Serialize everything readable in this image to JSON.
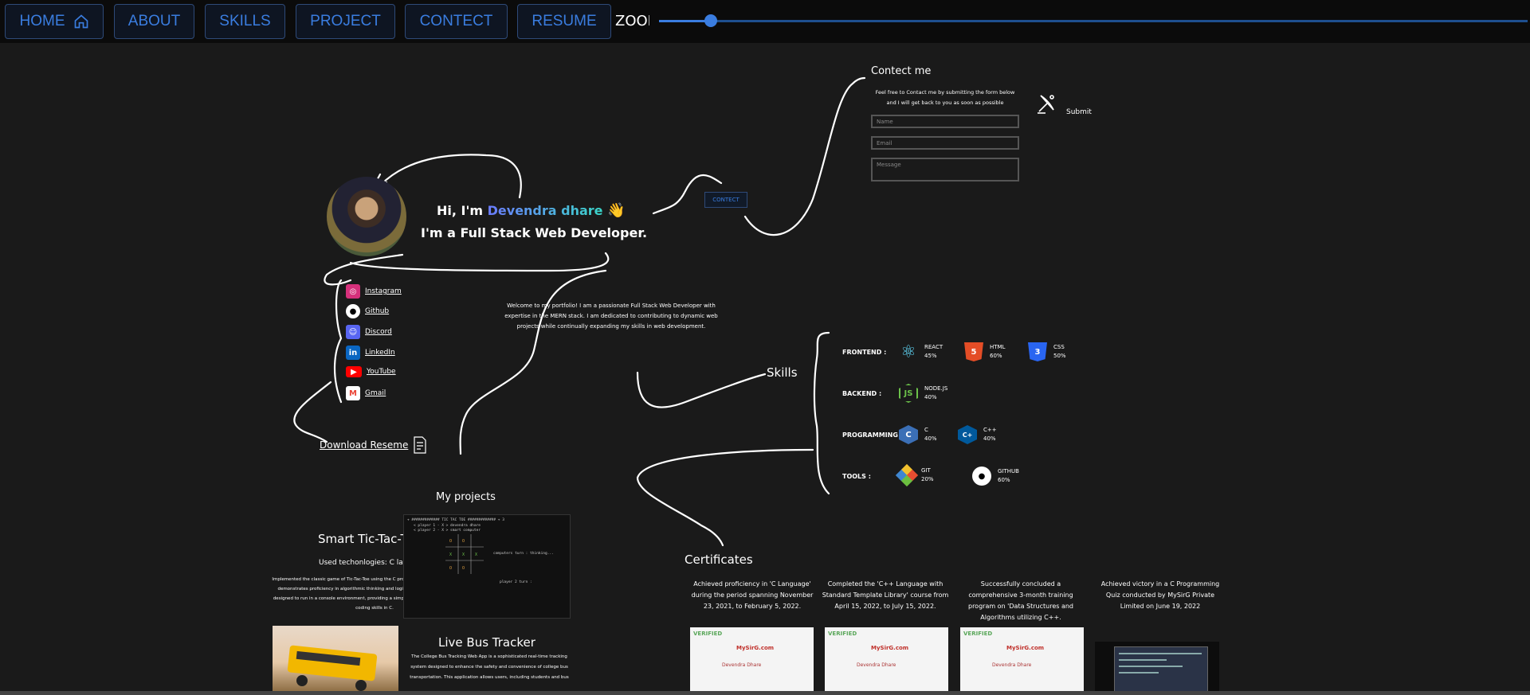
{
  "nav": {
    "home": "HOME",
    "about": "ABOUT",
    "skills": "SKILLS",
    "project": "PROJECT",
    "contect": "CONTECT",
    "resume": "RESUME"
  },
  "zoom": {
    "label": "ZOOM",
    "value": 0.06
  },
  "hero": {
    "greeting_prefix": "Hi, I'm ",
    "name": "Devendra dhare",
    "wave": "👋",
    "role": "I'm a Full Stack Web Developer.",
    "intro": "Welcome to my portfolio! I am a passionate Full Stack Web Developer with expertise in the MERN stack. I am dedicated to contributing to dynamic web projects while continually expanding my skills in web development.",
    "contect_button": "CONTECT"
  },
  "social": [
    {
      "label": "Instagram",
      "icon": "instagram-icon",
      "color": "#d6307b"
    },
    {
      "label": "Github",
      "icon": "github-icon",
      "color": "#ffffff"
    },
    {
      "label": "Discord",
      "icon": "discord-icon",
      "color": "#5865f2"
    },
    {
      "label": "LinkedIn",
      "icon": "linkedin-icon",
      "color": "#0a66c2"
    },
    {
      "label": "YouTube",
      "icon": "youtube-icon",
      "color": "#ff0000"
    },
    {
      "label": "Gmail",
      "icon": "gmail-icon",
      "color": "#ea4335"
    }
  ],
  "resume": {
    "label": "Download Reseme"
  },
  "contact": {
    "title": "Contect me",
    "desc": "Feel free to Contact me by submitting the form below and I will get back to you as soon as possible",
    "name_placeholder": "Name",
    "email_placeholder": "Email",
    "message_placeholder": "Message",
    "submit": "Submit"
  },
  "skills": {
    "title": "Skills",
    "categories": {
      "frontend": "FRONTEND :",
      "backend": "BACKEND :",
      "programming": "PROGRAMMING :",
      "tools": "TOOLS :"
    },
    "items": {
      "react": {
        "name": "REACT",
        "level": "45%"
      },
      "html": {
        "name": "HTML",
        "level": "60%"
      },
      "css": {
        "name": "CSS",
        "level": "50%"
      },
      "node": {
        "name": "NODE.JS",
        "level": "40%"
      },
      "c": {
        "name": "C",
        "level": "40%"
      },
      "cpp": {
        "name": "C++",
        "level": "40%"
      },
      "git": {
        "name": "GIT",
        "level": "20%"
      },
      "github": {
        "name": "GITHUB",
        "level": "60%"
      }
    }
  },
  "projects": {
    "title": "My projects",
    "p1": {
      "title": "Smart Tic-Tac-Toi",
      "tech": "Used techonlogies: C language",
      "desc": "Implemented the classic game of Tic-Tac-Toe using the C programming language. This project demonstrates proficiency in algorithmic thinking and logic implementation. The game is designed to run in a console environment, providing a simple yet effective demonstration of coding skills in C.",
      "console_line1": "+ #############  TIC TAC TOE  ############# + 3",
      "console_line2": "< player 1 - X > devendra dhare",
      "console_line3": "< player 2 - X > smart computer",
      "console_turn": "computers turn :    thinking...",
      "console_p2": "player 2 turn :"
    },
    "p2": {
      "title": "Live Bus Tracker",
      "desc": "The College Bus Tracking Web App is a sophisticated real-time tracking system designed to enhance the safety and convenience of college bus transportation. This application allows users, including students and bus"
    }
  },
  "certificates": {
    "title": "Certificates",
    "items": [
      {
        "text": "Achieved proficiency in 'C Language' during the period spanning November 23, 2021, to February 5, 2022."
      },
      {
        "text": "Completed the 'C++ Language with Standard Template Library' course from April 15, 2022, to July 15, 2022."
      },
      {
        "text": "Successfully concluded a comprehensive 3-month training program on 'Data Structures and Algorithms utilizing C++."
      },
      {
        "text": "Achieved victory in a C Programming Quiz conducted by MySirG Private Limited on June 19, 2022"
      }
    ],
    "verified": "VERIFIED",
    "site": "MySirG.com",
    "holder": "Devendra Dhare"
  }
}
